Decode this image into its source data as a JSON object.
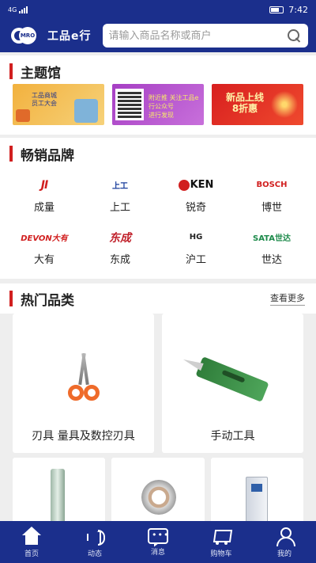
{
  "status_bar": {
    "signal": "4G",
    "time": "7:42"
  },
  "header": {
    "logo_mark": "MRO",
    "logo_text": "工品e行",
    "search_placeholder": "请输入商品名称或商户"
  },
  "themes": {
    "title": "主题馆",
    "banners": [
      {
        "text_line1": "工品商城",
        "text_line2": "员工大会"
      },
      {
        "text_line1": "附近推  关注工品e行公众号",
        "text_line2": "进行发现"
      },
      {
        "text_line1": "新品上线",
        "text_line2": "8折惠"
      }
    ]
  },
  "brands": {
    "title": "畅销品牌",
    "items": [
      {
        "logo": "JI",
        "name": "成量"
      },
      {
        "logo": "上工",
        "name": "上工"
      },
      {
        "logo": "KEN",
        "name": "锐奇"
      },
      {
        "logo": "BOSCH",
        "name": "博世"
      },
      {
        "logo": "DEVON大有",
        "name": "大有"
      },
      {
        "logo": "东成",
        "name": "东成"
      },
      {
        "logo": "HG",
        "name": "沪工"
      },
      {
        "logo": "SATA世达",
        "name": "世达"
      }
    ]
  },
  "hot_categories": {
    "title": "热门品类",
    "more_label": "查看更多",
    "items": [
      {
        "label": "刃具 量具及数控刃具"
      },
      {
        "label": "手动工具"
      }
    ]
  },
  "bottom_nav": {
    "items": [
      {
        "label": "首页",
        "icon": "home-icon"
      },
      {
        "label": "动态",
        "icon": "speaker-icon"
      },
      {
        "label": "消息",
        "icon": "message-icon"
      },
      {
        "label": "购物车",
        "icon": "cart-icon"
      },
      {
        "label": "我的",
        "icon": "user-icon"
      }
    ]
  },
  "colors": {
    "brand_blue": "#1b2f8c",
    "accent_red": "#d11f1f"
  }
}
